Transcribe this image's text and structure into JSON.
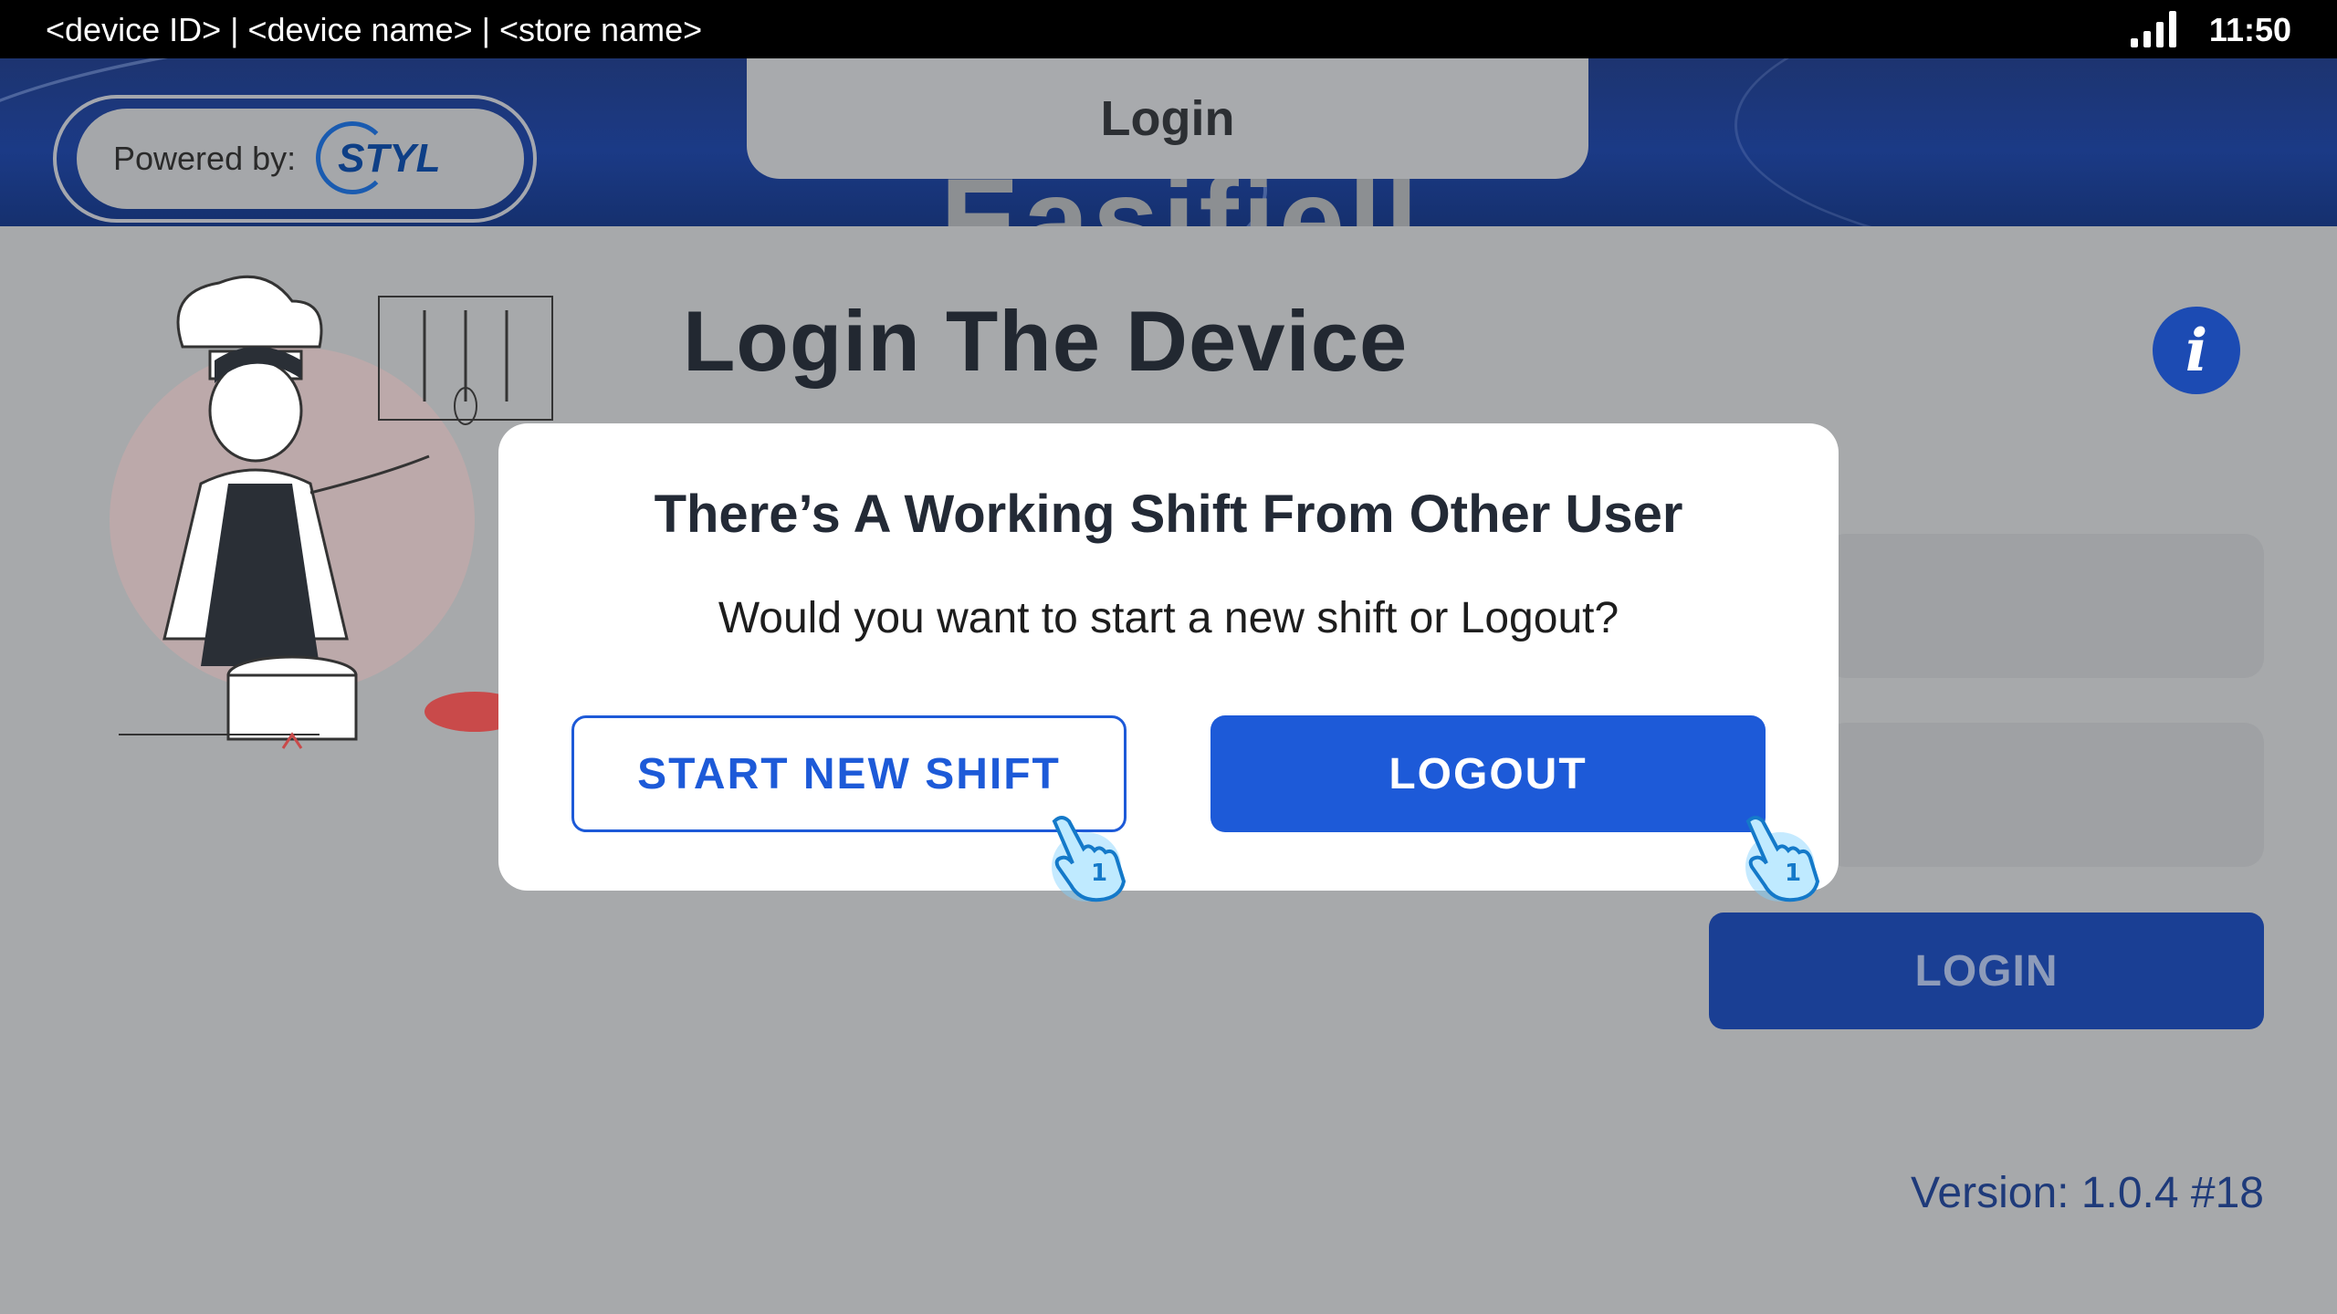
{
  "status_bar": {
    "device_info": "<device ID> | <device name> | <store name>",
    "time": "11:50",
    "signal_icon": "signal-bars-icon"
  },
  "header": {
    "powered_by_label": "Powered by:",
    "brand_logo_text": "STYL",
    "tab_title": "Login"
  },
  "main": {
    "title": "Login The Device",
    "info_icon": "info-icon",
    "login_button": "LOGIN",
    "version": "Version: 1.0.4 #18"
  },
  "dialog": {
    "title": "There’s A Working Shift From Other User",
    "message": "Would you want to start a new shift or Logout?",
    "start_button": "START NEW SHIFT",
    "logout_button": "LOGOUT",
    "tap_hint_icon": "tap-hand-icon",
    "tap_badge": "1"
  },
  "colors": {
    "primary": "#1d5ad8",
    "banner": "#1b3a86",
    "overlay": "#a7a9ab"
  }
}
